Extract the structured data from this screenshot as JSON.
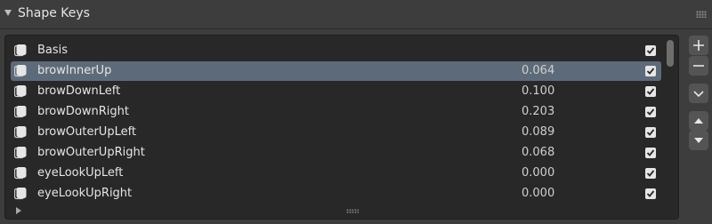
{
  "panel": {
    "title": "Shape Keys",
    "collapse_icon": "triangle-down-icon",
    "drag_icon": "grip-dots-icon"
  },
  "shape_keys": [
    {
      "name": "Basis",
      "value": "",
      "enabled": true,
      "selected": false
    },
    {
      "name": "browInnerUp",
      "value": "0.064",
      "enabled": true,
      "selected": true
    },
    {
      "name": "browDownLeft",
      "value": "0.100",
      "enabled": true,
      "selected": false
    },
    {
      "name": "browDownRight",
      "value": "0.203",
      "enabled": true,
      "selected": false
    },
    {
      "name": "browOuterUpLeft",
      "value": "0.089",
      "enabled": true,
      "selected": false
    },
    {
      "name": "browOuterUpRight",
      "value": "0.068",
      "enabled": true,
      "selected": false
    },
    {
      "name": "eyeLookUpLeft",
      "value": "0.000",
      "enabled": true,
      "selected": false
    },
    {
      "name": "eyeLookUpRight",
      "value": "0.000",
      "enabled": true,
      "selected": false
    }
  ],
  "side_buttons": [
    "add-icon",
    "remove-icon",
    "specials-menu-icon",
    "move-up-icon",
    "move-down-icon"
  ],
  "colors": {
    "panel_bg": "#3d3d3d",
    "list_bg": "#282828",
    "selected_row": "#5d6a79",
    "text": "#e6e6e6"
  }
}
